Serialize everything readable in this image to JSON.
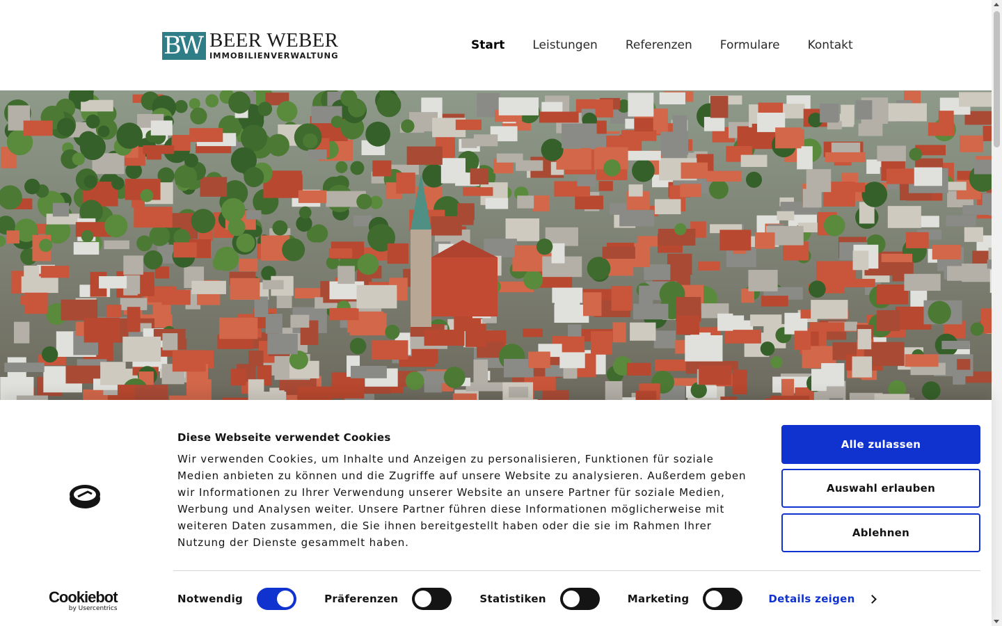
{
  "header": {
    "logo": {
      "mark": "BW",
      "name": "BEER WEBER",
      "subtitle": "IMMOBILIENVERWALTUNG"
    },
    "nav": [
      "Start",
      "Leistungen",
      "Referenzen",
      "Formulare",
      "Kontakt"
    ],
    "active_nav": "Start"
  },
  "hero": {
    "image": "aerial-city-photo"
  },
  "cookie_banner": {
    "title": "Diese Webseite verwendet Cookies",
    "text": "Wir verwenden Cookies, um Inhalte und Anzeigen zu personalisieren, Funktionen für soziale Medien anbieten zu können und die Zugriffe auf unsere Website zu analysieren. Außerdem geben wir Informationen zu Ihrer Verwendung unserer Website an unsere Partner für soziale Medien, Werbung und Analysen weiter. Unsere Partner führen diese Informationen möglicherweise mit weiteren Daten zusammen, die Sie ihnen bereitgestellt haben oder die sie im Rahmen Ihrer Nutzung der Dienste gesammelt haben.",
    "buttons": {
      "allow_all": "Alle zulassen",
      "allow_selection": "Auswahl erlauben",
      "deny": "Ablehnen"
    },
    "toggles": [
      {
        "label": "Notwendig",
        "on": true
      },
      {
        "label": "Präferenzen",
        "on": false
      },
      {
        "label": "Statistiken",
        "on": false
      },
      {
        "label": "Marketing",
        "on": false
      }
    ],
    "details_link": "Details zeigen",
    "brand": {
      "name": "Cookiebot",
      "sub": "by Usercentrics"
    }
  },
  "colors": {
    "accent": "#1032cf",
    "logo_teal": "#2f7d86",
    "text": "#141414"
  }
}
